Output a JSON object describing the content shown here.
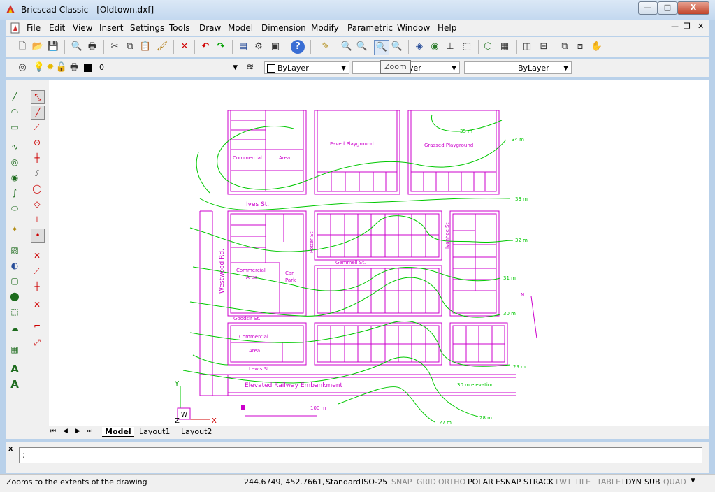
{
  "window": {
    "title": "Bricscad Classic - [Oldtown.dxf]",
    "minimize_label": "—",
    "maximize_label": "□",
    "close_label": "X"
  },
  "menu": [
    "File",
    "Edit",
    "View",
    "Insert",
    "Settings",
    "Tools",
    "Draw",
    "Model",
    "Dimension",
    "Modify",
    "Parametric",
    "Window",
    "Help"
  ],
  "layer_bar": {
    "layer_value": "0",
    "color_value": "ByLayer",
    "linetype_value": "yer",
    "lineweight_value": "ByLayer",
    "tooltip": "Zoom"
  },
  "colors": {
    "accent_magenta": "#cc00cc",
    "contour_green": "#00c800",
    "canvas_bg": "#ffffff",
    "chrome_bg": "#f0f0f0"
  },
  "drawing": {
    "streets": [
      "Ives St.",
      "Westwood Rd.",
      "Potter St.",
      "Ivanhoe St.",
      "Gemmell St.",
      "Goodsir St.",
      "Lewis St."
    ],
    "areas": {
      "commercial": "Commercial",
      "area": "Area",
      "car": "Car",
      "park": "Park",
      "paved_playground": "Paved Playground",
      "grassed_playground": "Grassed Playground",
      "embankment": "Elevated Railway Embankment",
      "elevation_note": "30 m elevation",
      "scale": "100 m",
      "north": "N"
    },
    "contours": [
      "35 m",
      "34 m",
      "33 m",
      "32 m",
      "31 m",
      "30 m",
      "29 m",
      "28 m",
      "27 m"
    ],
    "ucs": {
      "y": "Y",
      "x": "X",
      "z": "Z",
      "w": "W"
    }
  },
  "tabs": {
    "model": "Model",
    "layout1": "Layout1",
    "layout2": "Layout2"
  },
  "command": {
    "prompt": ":",
    "close_label": "x"
  },
  "status": {
    "message": "Zooms to the extents of the drawing",
    "coords": "244.6749, 452.7661, 0",
    "dim_style": "Standard",
    "text_style": "ISO-25",
    "toggles": [
      {
        "label": "SNAP",
        "on": false
      },
      {
        "label": "GRID",
        "on": false
      },
      {
        "label": "ORTHO",
        "on": false
      },
      {
        "label": "POLAR",
        "on": true
      },
      {
        "label": "ESNAP",
        "on": true
      },
      {
        "label": "STRACK",
        "on": true
      },
      {
        "label": "LWT",
        "on": false
      },
      {
        "label": "TILE",
        "on": false
      },
      {
        "label": "TABLET",
        "on": false
      },
      {
        "label": "DYN",
        "on": true
      },
      {
        "label": "SUB",
        "on": true
      },
      {
        "label": "QUAD",
        "on": false
      }
    ]
  }
}
